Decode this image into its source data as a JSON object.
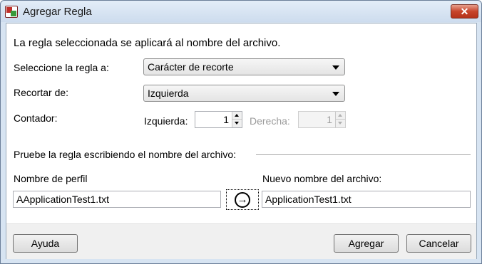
{
  "window": {
    "title": "Agregar Regla",
    "close_glyph": "✕"
  },
  "intro": "La regla seleccionada se aplicará al nombre del archivo.",
  "rule_select": {
    "label": "Seleccione la regla a:",
    "value": "Carácter de recorte"
  },
  "trim_from": {
    "label": "Recortar de:",
    "value": "Izquierda"
  },
  "counter": {
    "label": "Contador:",
    "left_label": "Izquierda:",
    "left_value": "1",
    "right_label": "Derecha:",
    "right_value": "1"
  },
  "test_section": {
    "heading": "Pruebe la regla escribiendo el nombre del archivo:",
    "profile_label": "Nombre de perfil",
    "profile_value": "AApplicationTest1.txt",
    "new_name_label": "Nuevo nombre del archivo:",
    "new_name_value": "ApplicationTest1.txt",
    "apply_glyph": "→"
  },
  "buttons": {
    "help": "Ayuda",
    "add": "Agregar",
    "cancel": "Cancelar"
  },
  "icons": [
    "app-icon",
    "close-icon",
    "dropdown-arrow-icon",
    "spin-up-icon",
    "spin-down-icon",
    "arrow-right-circle-icon"
  ]
}
